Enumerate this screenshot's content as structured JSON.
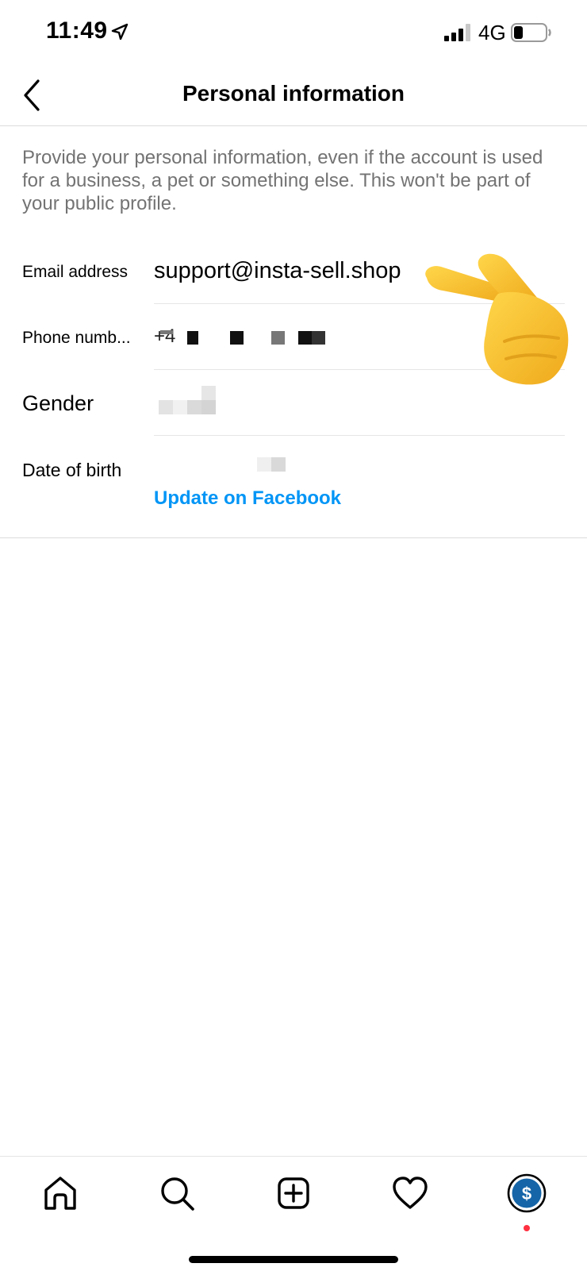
{
  "status_bar": {
    "time": "11:49",
    "network": "4G",
    "location_icon": "location-arrow-icon",
    "signal_icon": "cellular-signal-icon",
    "battery_icon": "battery-low-icon"
  },
  "header": {
    "title": "Personal information",
    "back_icon": "chevron-left-icon"
  },
  "description": "Provide your personal information, even if the account is used for a business, a pet or something else. This won't be part of your public profile.",
  "fields": {
    "email": {
      "label": "Email address",
      "value": "support@insta-sell.shop"
    },
    "phone": {
      "label": "Phone numb...",
      "value_prefix": "+4"
    },
    "gender": {
      "label": "Gender"
    },
    "date_of_birth": {
      "label": "Date of birth"
    }
  },
  "update_link": "Update on Facebook",
  "tab_bar": {
    "items": [
      {
        "name": "home",
        "icon": "home-icon"
      },
      {
        "name": "search",
        "icon": "search-icon"
      },
      {
        "name": "new-post",
        "icon": "plus-square-icon"
      },
      {
        "name": "activity",
        "icon": "heart-icon"
      },
      {
        "name": "profile",
        "icon": "dollar-avatar-icon"
      }
    ]
  },
  "colors": {
    "link": "#0095f6",
    "description_text": "#737373",
    "divider": "#dbdbdb",
    "profile_avatar": "#1565a8",
    "notification_dot": "#ff3040",
    "hand_emoji": "#f7c02a"
  }
}
